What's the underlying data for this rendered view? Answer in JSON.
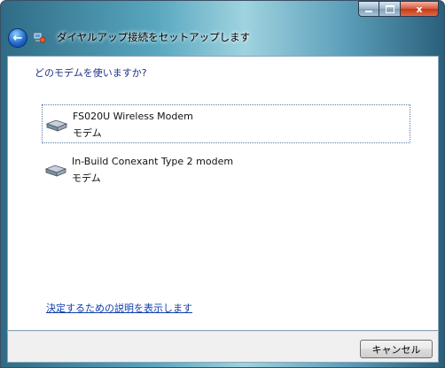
{
  "window": {
    "title": "ダイヤルアップ接続をセットアップします",
    "minimize_icon": "minimize-icon",
    "maximize_icon": "maximize-icon",
    "close_icon": "close-icon",
    "close_glyph": "x"
  },
  "nav": {
    "back_icon": "back-arrow-icon",
    "back_glyph": "←",
    "app_icon": "dialup-connection-icon"
  },
  "main": {
    "prompt": "どのモデムを使いますか?",
    "modems": [
      {
        "name": "FS020U Wireless Modem",
        "type": "モデム",
        "icon": "modem-icon",
        "selected": true
      },
      {
        "name": "In-Build Conexant Type 2 modem",
        "type": "モデム",
        "icon": "modem-icon",
        "selected": false
      }
    ],
    "help_link": "決定するための説明を表示します"
  },
  "footer": {
    "cancel_label": "キャンセル"
  }
}
